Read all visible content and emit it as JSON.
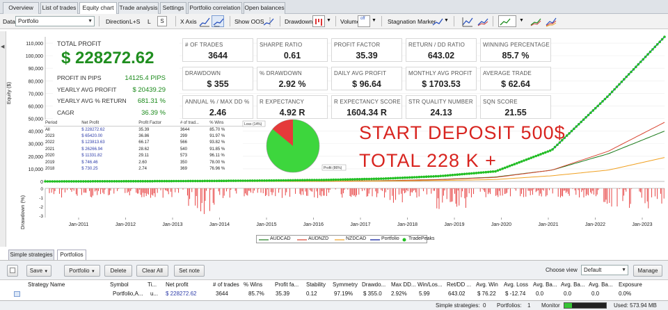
{
  "tabs": [
    {
      "label": "Overview"
    },
    {
      "label": "List of trades"
    },
    {
      "label": "Equity chart"
    },
    {
      "label": "Trade analysis"
    },
    {
      "label": "Settings"
    },
    {
      "label": "Portfolio correlation"
    },
    {
      "label": "Open balances"
    }
  ],
  "toolbar": {
    "data_label": "Data",
    "data_value": "Portfolio",
    "direction_label": "Direction",
    "direction_value": "L+S",
    "dir_l": "L",
    "dir_s": "S",
    "xaxis_label": "X Axis",
    "showoos_label": "Show OOS",
    "drawdown_label": "Drawdown",
    "volume_label": "Volume",
    "volume_value": "off",
    "stagnation_label": "Stagnation Marker"
  },
  "stats": {
    "total_profit_label": "TOTAL PROFIT",
    "total_profit": "$ 228272.62",
    "rows": [
      {
        "label": "PROFIT IN PIPS",
        "value": "14125.4 PIPS"
      },
      {
        "label": "YEARLY AVG PROFIT",
        "value": "$ 20439.29"
      },
      {
        "label": "YEARLY AVG % RETURN",
        "value": "681.31 %"
      },
      {
        "label": "CAGR",
        "value": "36.39 %"
      }
    ],
    "cards": [
      {
        "label": "# of Trades",
        "value": "3644"
      },
      {
        "label": "Sharpe Ratio",
        "value": "0.61"
      },
      {
        "label": "Profit Factor",
        "value": "35.39"
      },
      {
        "label": "Return / DD Ratio",
        "value": "643.02"
      },
      {
        "label": "Winning Percentage",
        "value": "85.7 %"
      },
      {
        "label": "Drawdown",
        "value": "$ 355"
      },
      {
        "label": "% Drawdown",
        "value": "2.92 %"
      },
      {
        "label": "Daily Avg Profit",
        "value": "$ 96.64"
      },
      {
        "label": "Monthly Avg Profit",
        "value": "$ 1703.53"
      },
      {
        "label": "Average Trade",
        "value": "$ 62.64"
      },
      {
        "label": "Annual % / Max DD %",
        "value": "2.46"
      },
      {
        "label": "R Expectancy",
        "value": "4.92 R"
      },
      {
        "label": "R Expectancy Score",
        "value": "1604.34 R"
      },
      {
        "label": "STR Quality Number",
        "value": "24.13"
      },
      {
        "label": "SQN Score",
        "value": "21.55"
      }
    ]
  },
  "period_table": {
    "headers": [
      "Period",
      "Net Profit",
      "Profit Factor",
      "# of trad...",
      "% Wins"
    ],
    "rows": [
      [
        "All",
        "$ 228272.62",
        "35.39",
        "3644",
        "85.70 %"
      ],
      [
        "2023",
        "$ 65420.00",
        "36.86",
        "299",
        "91.97 %"
      ],
      [
        "2022",
        "$ 123813.63",
        "66.17",
        "566",
        "93.82 %"
      ],
      [
        "2021",
        "$ 26266.94",
        "28.62",
        "540",
        "91.85 %"
      ],
      [
        "2020",
        "$ 11331.82",
        "29.11",
        "573",
        "96.11 %"
      ],
      [
        "2019",
        "$ 746.46",
        "2.60",
        "350",
        "78.00 %"
      ],
      [
        "2018",
        "$ 730.25",
        "2.74",
        "369",
        "76.96 %"
      ]
    ]
  },
  "pie": {
    "loss_label": "Loss (14%)",
    "profit_label": "Profit (86%)",
    "loss_pct": 14,
    "profit_pct": 86,
    "loss_color": "#e53a3a",
    "profit_color": "#3dd63d"
  },
  "overlay": {
    "line1": "START DEPOSIT   500$",
    "line2": "TOTAL     228 K +"
  },
  "chart_data": {
    "type": "line",
    "ylabel": "Equity ($)",
    "dd_label": "Drawdown (%)",
    "yticks": [
      "110,000",
      "100,000",
      "90,000",
      "80,000",
      "70,000",
      "60,000",
      "50,000",
      "40,000",
      "30,000",
      "20,000",
      "10,000",
      "0"
    ],
    "ylim": [
      0,
      115000
    ],
    "dd_ticks": [
      "0",
      "-1",
      "-2",
      "-3"
    ],
    "xticks": [
      "Jan-2011",
      "Jan-2012",
      "Jan-2013",
      "Jan-2014",
      "Jan-2015",
      "Jan-2016",
      "Jan-2017",
      "Jan-2018",
      "Jan-2019",
      "Jan-2020",
      "Jan-2021",
      "Jan-2022",
      "Jan-2023"
    ],
    "series": [
      {
        "name": "AUDCAD",
        "color": "#1a7a1a",
        "values": [
          0,
          0,
          0,
          0,
          0,
          200,
          600,
          1500,
          3500,
          9000,
          22000,
          40000
        ]
      },
      {
        "name": "AUDNZD",
        "color": "#d9432f",
        "values": [
          0,
          0,
          0,
          0,
          0,
          200,
          500,
          1400,
          3200,
          9000,
          24000,
          47000
        ]
      },
      {
        "name": "NZDCAD",
        "color": "#f0a020",
        "values": [
          0,
          0,
          0,
          0,
          0,
          100,
          300,
          700,
          1500,
          4500,
          9000,
          19000
        ]
      },
      {
        "name": "Portfolio",
        "color": "#2332a8",
        "values": [
          0,
          100,
          200,
          400,
          700,
          1200,
          2200,
          4200,
          8000,
          25000,
          68000,
          115000
        ]
      },
      {
        "name": "TradePeaks",
        "color": "#22c022",
        "values": []
      }
    ]
  },
  "legend": [
    "AUDCAD",
    "AUDNZD",
    "NZDCAD",
    "Portfolio",
    "TradePeaks"
  ],
  "bottom_tabs": [
    {
      "label": "Simple strategies"
    },
    {
      "label": "Portfolios"
    }
  ],
  "buttons": {
    "save": "Save",
    "portfolio": "Portfolio",
    "delete": "Delete",
    "clear_all": "Clear All",
    "set_note": "Set note",
    "choose_view": "Choose view",
    "view_value": "Default",
    "manage": "Manage"
  },
  "grid": {
    "headers": [
      "Strategy Name",
      "Symbol",
      "Ti...",
      "Net profit",
      "# of trades",
      "% Wins",
      "Profit fa...",
      "Stability",
      "Symmetry",
      "Drawdo...",
      "Max DD...",
      "Win/Los...",
      "Ret/DD ...",
      "Avg. Win",
      "Avg. Loss",
      "Avg. Ba...",
      "Avg. Ba...",
      "Avg. Ba...",
      "Exposure"
    ],
    "row": [
      "",
      "Portfolio,A...",
      "u...",
      "$ 228272.62",
      "3644",
      "85.7%",
      "35.39",
      "0.12",
      "97.19%",
      "$ 355.0",
      "2.92%",
      "5.99",
      "643.02",
      "$ 76.22",
      "$ -12.74",
      "0.0",
      "0.0",
      "0.0",
      "0.0%"
    ]
  },
  "status": {
    "simple_label": "Simple strategies:",
    "simple_value": "0",
    "portfolios_label": "Portfolios:",
    "portfolios_value": "1",
    "monitor_label": "Monitor",
    "used_label": "Used: 573.94 MB"
  }
}
